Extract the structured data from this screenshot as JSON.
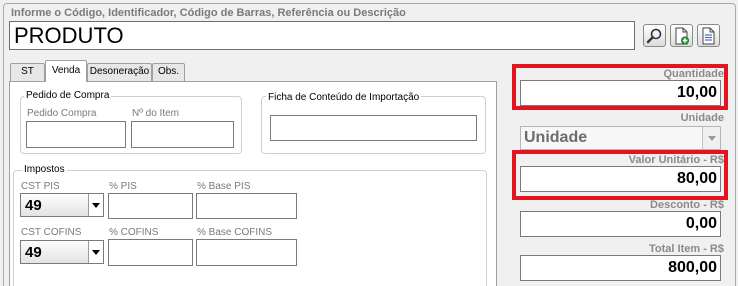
{
  "search": {
    "caption": "Informe o Código, Identificador, Código de Barras, Referência ou Descrição",
    "value": "PRODUTO"
  },
  "toolbar": {
    "buttons": [
      {
        "icon": "magnifier-icon"
      },
      {
        "icon": "add-document-icon"
      },
      {
        "icon": "document-icon"
      }
    ]
  },
  "tabs": [
    {
      "label": "ST",
      "active": false
    },
    {
      "label": "Venda",
      "active": true
    },
    {
      "label": "Desoneração",
      "active": false
    },
    {
      "label": "Obs.",
      "active": false
    }
  ],
  "pedido_compra": {
    "title": "Pedido de Compra",
    "pedido_label": "Pedido Compra",
    "pedido_value": "",
    "item_label": "Nº do Item",
    "item_value": ""
  },
  "ficha": {
    "title": "Ficha de Conteúdo de Importação",
    "value": ""
  },
  "impostos": {
    "title": "Impostos",
    "cst_pis_label": "CST PIS",
    "cst_pis_value": "49",
    "pis_label": "% PIS",
    "pis_value": "",
    "base_pis_label": "% Base PIS",
    "base_pis_value": "",
    "cst_cofins_label": "CST COFINS",
    "cst_cofins_value": "49",
    "cofins_label": "% COFINS",
    "cofins_value": "",
    "base_cofins_label": "% Base COFINS",
    "base_cofins_value": ""
  },
  "totals": {
    "quantidade_label": "Quantidade",
    "quantidade_value": "10,00",
    "unidade_label": "Unidade",
    "unidade_value": "Unidade",
    "valor_unitario_label": "Valor Unitário - R$",
    "valor_unitario_value": "80,00",
    "desconto_label": "Desconto - R$",
    "desconto_value": "0,00",
    "total_item_label": "Total Item - R$",
    "total_item_value": "800,00"
  },
  "colors": {
    "highlight": "#e2141f",
    "label_gray": "#8a8a8a"
  }
}
